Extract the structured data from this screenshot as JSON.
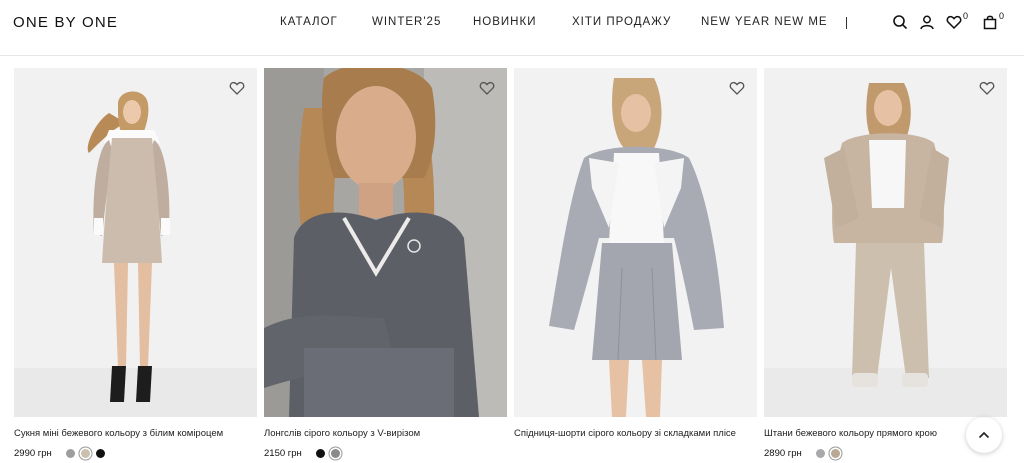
{
  "brand": {
    "logo": "ONE BY ONE"
  },
  "nav": {
    "items": [
      "КАТАЛОГ",
      "WINTER'25",
      "НОВИНКИ",
      "ХІТИ ПРОДАЖУ",
      "NEW YEAR NEW ME"
    ]
  },
  "header_icons": {
    "search": "search-icon",
    "account": "user-icon",
    "wishlist": "heart-icon",
    "wishlist_count": "0",
    "cart": "bag-icon",
    "cart_count": "0"
  },
  "products": [
    {
      "name": "Сукня міні бежевого кольору з білим коміроцем",
      "price": "2990 грн",
      "swatches": [
        "#9e9e9e",
        "#cbbfb0",
        "#111111"
      ],
      "selected": 1
    },
    {
      "name": "Лонгслів сірого кольору з V-вирізом",
      "price": "2150 грн",
      "swatches": [
        "#111111",
        "#8a8a8a"
      ],
      "selected": 1
    },
    {
      "name": "Спідниця-шорти сірого кольору зі складками плісе",
      "price": "",
      "swatches": [],
      "selected": -1
    },
    {
      "name": "Штани бежевого кольору прямого крою",
      "price": "2890 грн",
      "swatches": [
        "#a8a8a8",
        "#b8a894"
      ],
      "selected": 1
    }
  ],
  "scroll_top": "chevron-up-icon",
  "colors": {
    "accent": "#111111",
    "border": "#e6e6e6"
  }
}
